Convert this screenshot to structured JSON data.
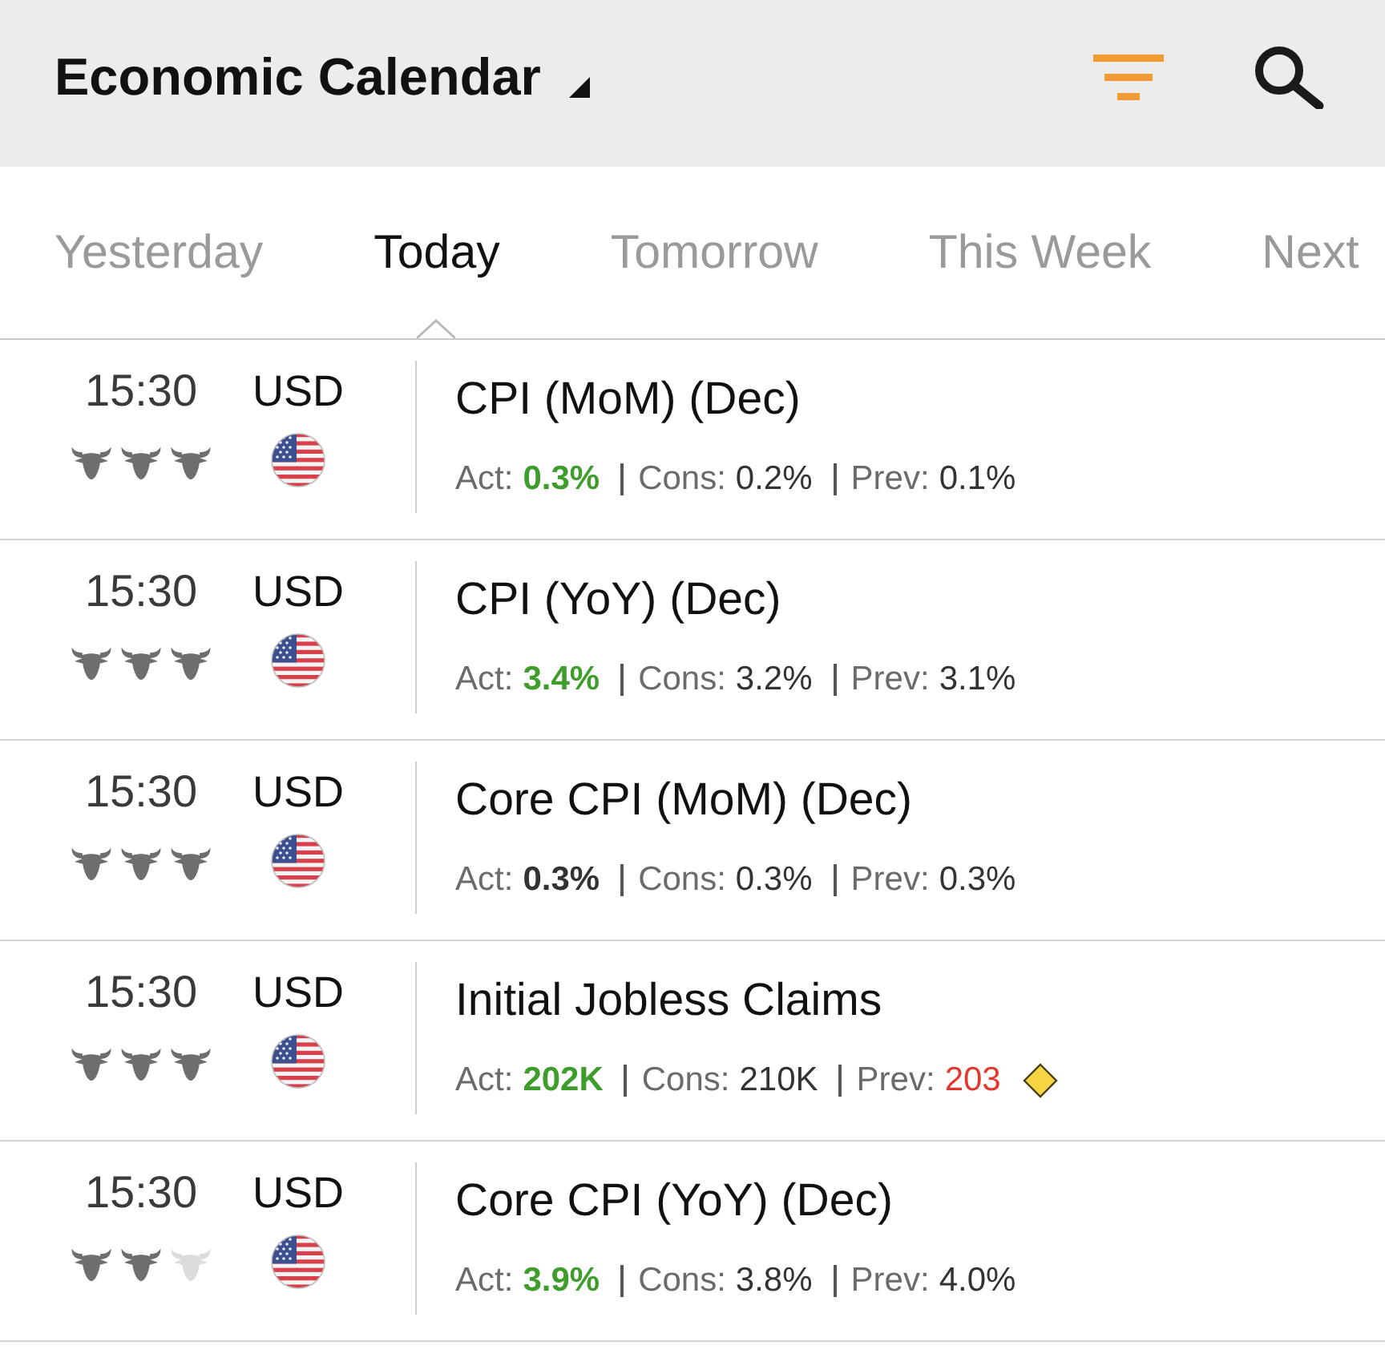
{
  "header": {
    "title": "Economic Calendar"
  },
  "tabs": [
    {
      "label": "Yesterday",
      "selected": false
    },
    {
      "label": "Today",
      "selected": true
    },
    {
      "label": "Tomorrow",
      "selected": false
    },
    {
      "label": "This Week",
      "selected": false
    },
    {
      "label": "Next",
      "selected": false
    }
  ],
  "events": [
    {
      "time": "15:30",
      "currency": "USD",
      "stars": 3,
      "name": "CPI (MoM) (Dec)",
      "actual": {
        "label": "Act:",
        "value": "0.3%",
        "color": "#3f9d2c"
      },
      "consensus": {
        "label": "Cons:",
        "value": "0.2%"
      },
      "previous": {
        "label": "Prev:",
        "value": "0.1%",
        "color": "#333333",
        "revised": false
      }
    },
    {
      "time": "15:30",
      "currency": "USD",
      "stars": 3,
      "name": "CPI (YoY) (Dec)",
      "actual": {
        "label": "Act:",
        "value": "3.4%",
        "color": "#3f9d2c"
      },
      "consensus": {
        "label": "Cons:",
        "value": "3.2%"
      },
      "previous": {
        "label": "Prev:",
        "value": "3.1%",
        "color": "#333333",
        "revised": false
      }
    },
    {
      "time": "15:30",
      "currency": "USD",
      "stars": 3,
      "name": "Core CPI (MoM) (Dec)",
      "actual": {
        "label": "Act:",
        "value": "0.3%",
        "color": "#333333"
      },
      "consensus": {
        "label": "Cons:",
        "value": "0.3%"
      },
      "previous": {
        "label": "Prev:",
        "value": "0.3%",
        "color": "#333333",
        "revised": false
      }
    },
    {
      "time": "15:30",
      "currency": "USD",
      "stars": 3,
      "name": "Initial Jobless Claims",
      "actual": {
        "label": "Act:",
        "value": "202K",
        "color": "#3f9d2c"
      },
      "consensus": {
        "label": "Cons:",
        "value": "210K"
      },
      "previous": {
        "label": "Prev:",
        "value": "203",
        "color": "#e1392f",
        "revised": true
      }
    },
    {
      "time": "15:30",
      "currency": "USD",
      "stars": 2,
      "name": "Core CPI (YoY) (Dec)",
      "actual": {
        "label": "Act:",
        "value": "3.9%",
        "color": "#3f9d2c"
      },
      "consensus": {
        "label": "Cons:",
        "value": "3.8%"
      },
      "previous": {
        "label": "Prev:",
        "value": "4.0%",
        "color": "#333333",
        "revised": false
      }
    }
  ]
}
